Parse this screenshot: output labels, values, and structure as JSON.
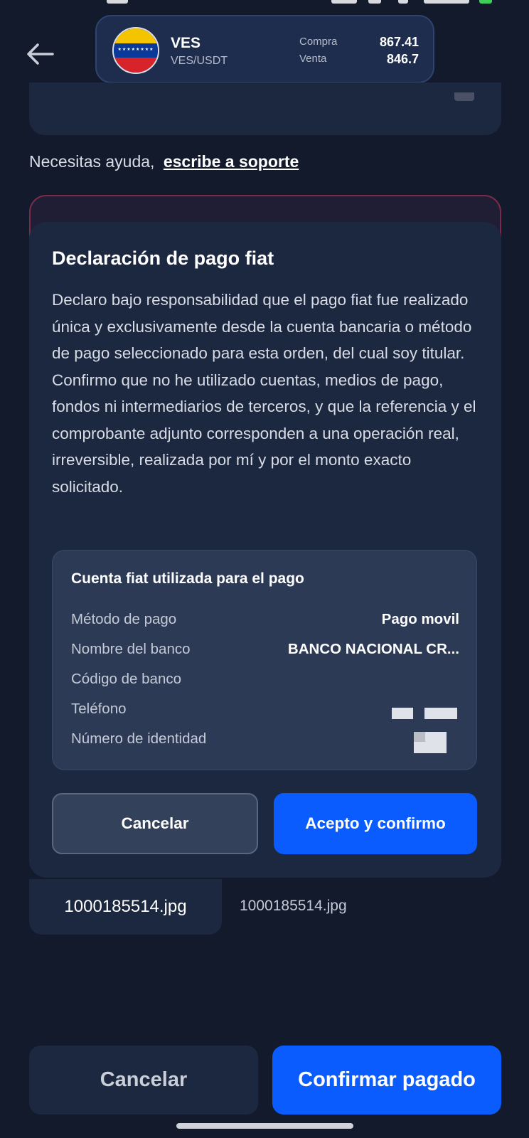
{
  "header": {
    "currency_code": "VES",
    "currency_pair": "VES/USDT",
    "buy_label": "Compra",
    "buy_value": "867.41",
    "sell_label": "Venta",
    "sell_value": "846.7",
    "flag_colors": [
      "#f4c400",
      "#0a3a99",
      "#d8232a"
    ]
  },
  "help": {
    "text": "Necesitas ayuda,",
    "link": "escribe a soporte"
  },
  "modal": {
    "title": "Declaración de pago fiat",
    "body": "Declaro bajo responsabilidad que el pago fiat fue realizado única y exclusivamente desde la cuenta bancaria o método de pago seleccionado para esta orden, del cual soy titular. Confirmo que no he utilizado cuentas, medios de pago, fondos ni intermediarios de terceros, y que la referencia y el comprobante adjunto corresponden a una operación real, irreversible, realizada por mí y por el monto exacto solicitado.",
    "account": {
      "title": "Cuenta fiat utilizada para el pago",
      "rows": [
        {
          "label": "Método de pago",
          "value": "Pago movil"
        },
        {
          "label": "Nombre del banco",
          "value": "BANCO NACIONAL CR..."
        },
        {
          "label": "Código de banco",
          "value": ""
        },
        {
          "label": "Teléfono",
          "value": ""
        },
        {
          "label": "Número de identidad",
          "value": ""
        }
      ]
    },
    "cancel_label": "Cancelar",
    "accept_label": "Acepto y confirmo"
  },
  "file": {
    "chip_name": "1000185514.jpg",
    "file_name": "1000185514.jpg"
  },
  "actions": {
    "cancel_label": "Cancelar",
    "confirm_label": "Confirmar pagado"
  },
  "colors": {
    "background": "#121a2c",
    "card": "#1c2740",
    "primary": "#0a5cff"
  }
}
